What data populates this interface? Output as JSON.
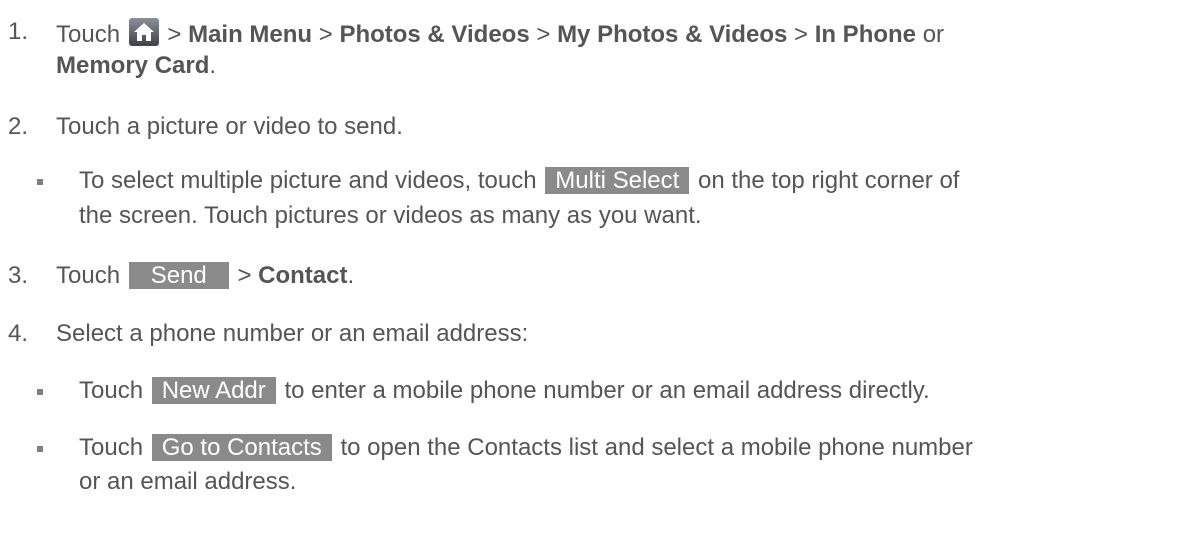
{
  "steps": [
    {
      "number": "1.",
      "touch": "Touch",
      "sep": ">",
      "path": [
        "Main Menu",
        "Photos & Videos",
        "My Photos & Videos",
        "In Phone"
      ],
      "or": "or",
      "last": "Memory Card",
      "end": "."
    },
    {
      "number": "2.",
      "text": "Touch a picture or video to send."
    },
    {
      "number": "3.",
      "touch": "Touch",
      "button": "Send",
      "sep": ">",
      "target": "Contact",
      "end": "."
    },
    {
      "number": "4.",
      "text": "Select a phone number or an email address:"
    }
  ],
  "bullets": {
    "multi": {
      "pre": "To select multiple picture and videos, touch",
      "button": "Multi Select",
      "post": "on the top right corner of",
      "line2": "the screen. Touch pictures or videos as many as you want."
    },
    "new_addr": {
      "pre": "Touch",
      "button": "New Addr",
      "post": "to enter a mobile phone number or an email address directly."
    },
    "contacts": {
      "pre": "Touch",
      "button": "Go to Contacts",
      "post": "to open the Contacts list and select a mobile phone number",
      "line2": "or an email address."
    }
  },
  "icons": {
    "home": "home-icon"
  },
  "colors": {
    "text": "#555555",
    "softkey_bg": "#8a8a8a",
    "softkey_text": "#ffffff"
  }
}
